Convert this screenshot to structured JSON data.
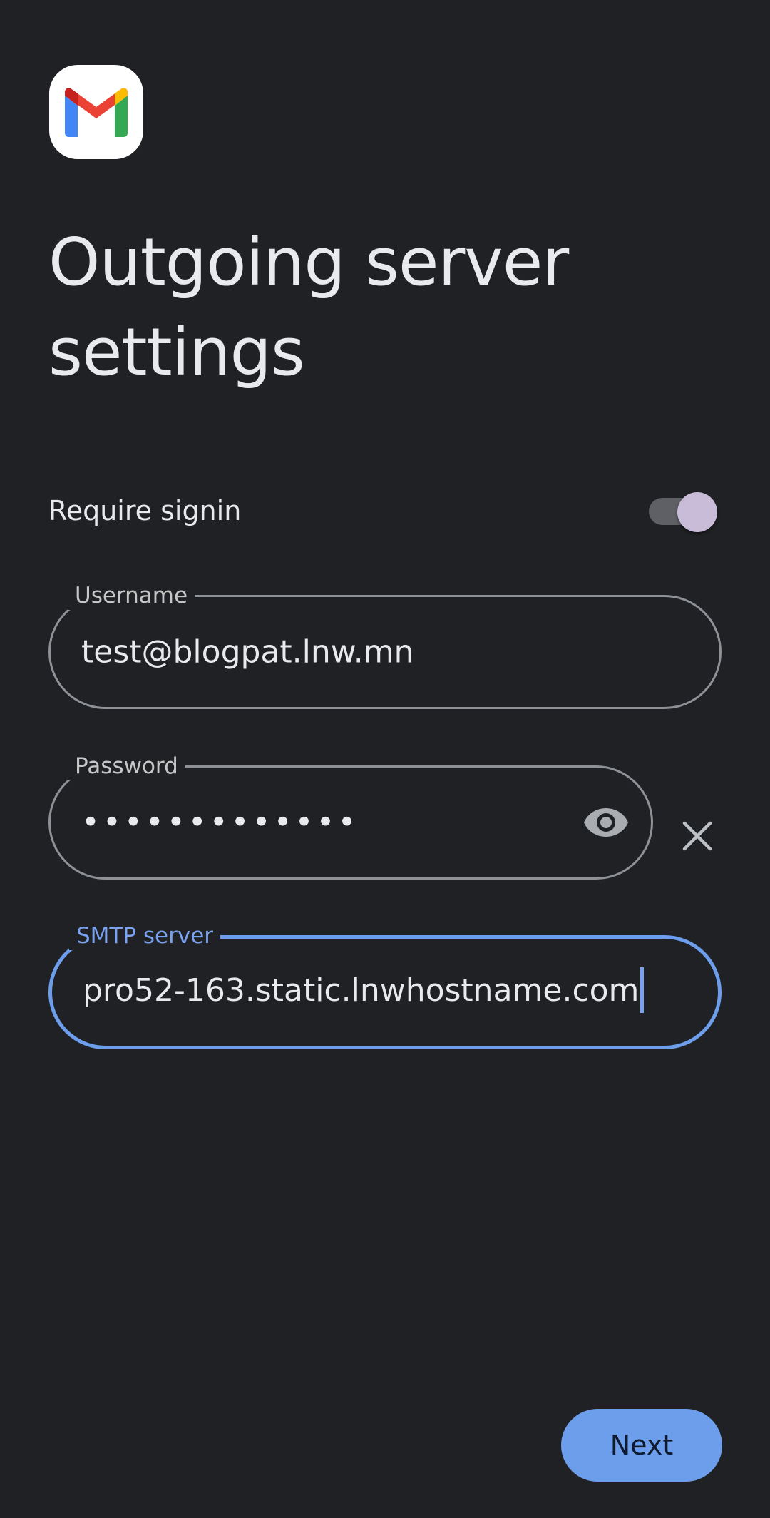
{
  "app": {
    "logo_icon": "gmail-logo-icon"
  },
  "header": {
    "title": "Outgoing server settings"
  },
  "require_signin": {
    "label": "Require signin",
    "enabled": true
  },
  "fields": {
    "username": {
      "label": "Username",
      "value": "test@blogpat.lnw.mn"
    },
    "password": {
      "label": "Password",
      "masked_value": "•••••••••••••",
      "visibility_icon": "eye-icon",
      "clear_icon": "close-icon"
    },
    "smtp_server": {
      "label": "SMTP server",
      "value": "pro52-163.static.lnwhostname.com",
      "focused": true
    }
  },
  "footer": {
    "next_label": "Next"
  },
  "colors": {
    "background": "#202124",
    "accent": "#6d9eeb",
    "toggle_thumb": "#c8bcd8",
    "outline": "#8e9196"
  }
}
